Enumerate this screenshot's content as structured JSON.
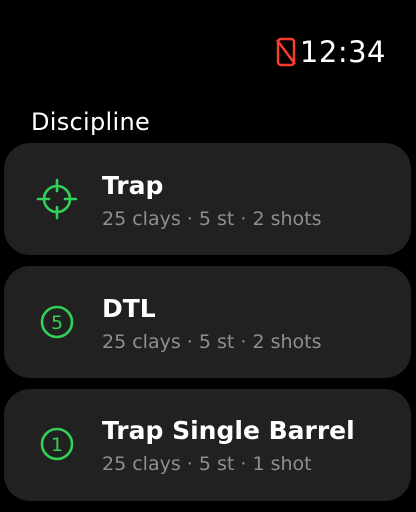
{
  "status": {
    "time": "12:34",
    "indicator_icon": "phone-disconnected-icon",
    "indicator_color": "#ff3b30"
  },
  "section": {
    "title": "Discipline"
  },
  "accent_color": "#30d158",
  "items": [
    {
      "title": "Trap",
      "subtitle": "25 clays · 5 st · 2 shots",
      "icon": "crosshair-icon"
    },
    {
      "title": "DTL",
      "subtitle": "25 clays · 5 st · 2 shots",
      "icon": "circled-five-icon",
      "icon_glyph": "5"
    },
    {
      "title": "Trap Single Barrel",
      "subtitle": "25 clays · 5 st · 1 shot",
      "icon": "circled-one-icon",
      "icon_glyph": "1"
    }
  ]
}
